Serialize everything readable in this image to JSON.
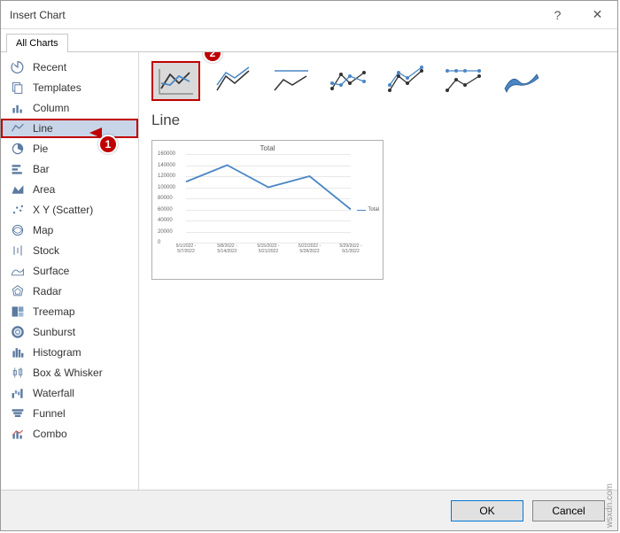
{
  "window": {
    "title": "Insert Chart",
    "help": "?",
    "close": "✕"
  },
  "tabs": {
    "all_charts": "All Charts"
  },
  "sidebar": {
    "items": [
      {
        "label": "Recent",
        "icon": "recent-icon"
      },
      {
        "label": "Templates",
        "icon": "templates-icon"
      },
      {
        "label": "Column",
        "icon": "column-icon"
      },
      {
        "label": "Line",
        "icon": "line-icon",
        "selected": true
      },
      {
        "label": "Pie",
        "icon": "pie-icon"
      },
      {
        "label": "Bar",
        "icon": "bar-icon"
      },
      {
        "label": "Area",
        "icon": "area-icon"
      },
      {
        "label": "X Y (Scatter)",
        "icon": "scatter-icon"
      },
      {
        "label": "Map",
        "icon": "map-icon"
      },
      {
        "label": "Stock",
        "icon": "stock-icon"
      },
      {
        "label": "Surface",
        "icon": "surface-icon"
      },
      {
        "label": "Radar",
        "icon": "radar-icon"
      },
      {
        "label": "Treemap",
        "icon": "treemap-icon"
      },
      {
        "label": "Sunburst",
        "icon": "sunburst-icon"
      },
      {
        "label": "Histogram",
        "icon": "histogram-icon"
      },
      {
        "label": "Box & Whisker",
        "icon": "boxwhisker-icon"
      },
      {
        "label": "Waterfall",
        "icon": "waterfall-icon"
      },
      {
        "label": "Funnel",
        "icon": "funnel-icon"
      },
      {
        "label": "Combo",
        "icon": "combo-icon"
      }
    ]
  },
  "subtypes": [
    {
      "name": "line",
      "selected": true
    },
    {
      "name": "stacked-line"
    },
    {
      "name": "100-stacked-line"
    },
    {
      "name": "line-markers"
    },
    {
      "name": "stacked-line-markers"
    },
    {
      "name": "100-stacked-line-markers"
    },
    {
      "name": "3d-line"
    }
  ],
  "chart_title": "Line",
  "annotations": {
    "badge1": "1",
    "badge2": "2"
  },
  "footer": {
    "ok": "OK",
    "cancel": "Cancel"
  },
  "watermark": "wsxdn.com",
  "chart_data": {
    "type": "line",
    "title": "Total",
    "legend": "Total",
    "ylim": [
      0,
      160000
    ],
    "yticks": [
      0,
      20000,
      40000,
      60000,
      80000,
      100000,
      120000,
      140000,
      160000
    ],
    "categories": [
      "5/1/2022 - 5/7/2022",
      "5/8/2022 - 5/14/2022",
      "5/15/2022 - 5/21/2022",
      "5/22/2022 - 5/28/2022",
      "5/29/2022 - 6/1/2022"
    ],
    "values": [
      110000,
      140000,
      100000,
      120000,
      60000
    ]
  }
}
